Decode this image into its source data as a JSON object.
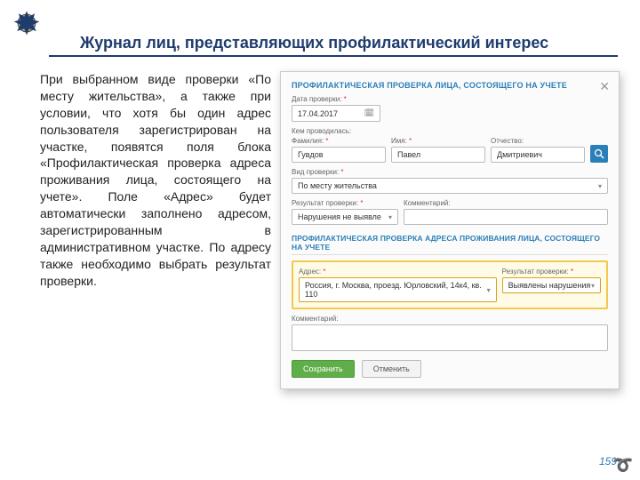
{
  "title": "Журнал лиц, представляющих профилактический интерес",
  "body": "При выбранном виде проверки «По месту жительства», а также при условии, что хотя бы один адрес пользователя зарегистрирован на участке, появятся поля блока «Профилактическая проверка адреса проживания лица, состоящего на учете». Поле «Адрес» будет автоматически заполнено адресом, зарегистрированным в административном участке. По адресу также необходимо выбрать результат проверки.",
  "dialog": {
    "header1": "ПРОФИЛАКТИЧЕСКАЯ ПРОВЕРКА ЛИЦА, СОСТОЯЩЕГО НА УЧЕТЕ",
    "date_label": "Дата проверки:",
    "date_value": "17.04.2017",
    "who_label": "Кем проводилась:",
    "fam_label": "Фамилия:",
    "fam_value": "Гувдов",
    "name_label": "Имя:",
    "name_value": "Павел",
    "patr_label": "Отчество:",
    "patr_value": "Дмитриевич",
    "kind_label": "Вид проверки:",
    "kind_value": "По месту жительства",
    "res_label": "Результат проверки:",
    "res_value": "Нарушения не выявле",
    "comment_label": "Комментарий:",
    "header2": "ПРОФИЛАКТИЧЕСКАЯ ПРОВЕРКА АДРЕСА ПРОЖИВАНИЯ ЛИЦА, СОСТОЯЩЕГО НА УЧЕТЕ",
    "addr_label": "Адрес:",
    "addr_value": "Россия, г. Москва, проезд. Юрловский, 14к4, кв. 110",
    "addr_res_label": "Результат проверки:",
    "addr_res_value": "Выявлены нарушения",
    "save": "Сохранить",
    "cancel": "Отменить"
  },
  "page": "159"
}
